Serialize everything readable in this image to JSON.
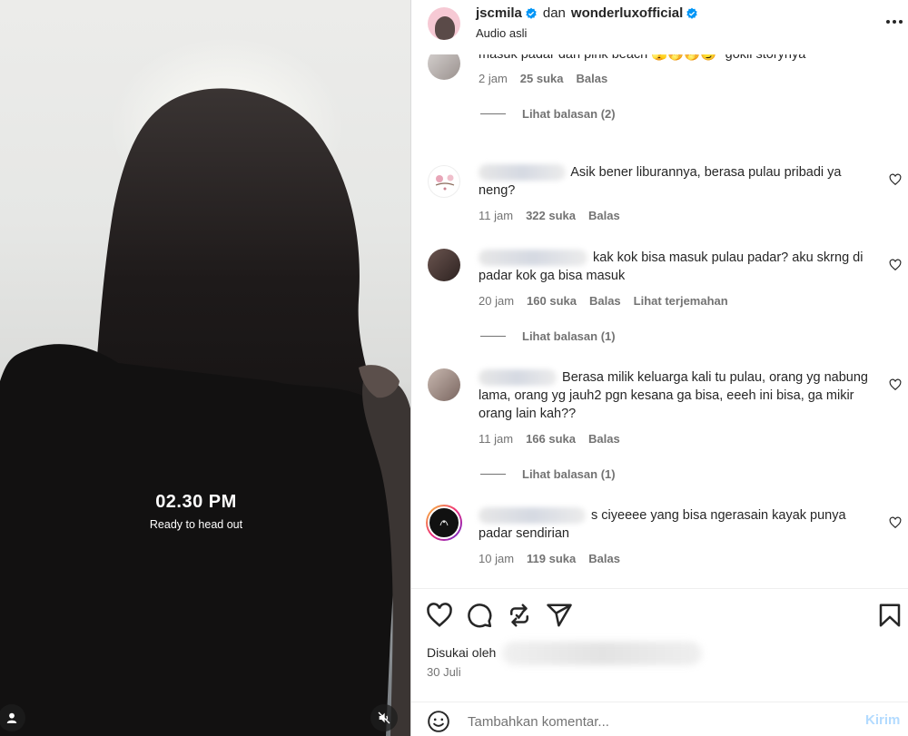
{
  "video": {
    "overlay_time": "02.30 PM",
    "overlay_caption": "Ready to head out",
    "mute_icon": "speaker-muted-icon",
    "user_icon": "user-tag-icon"
  },
  "header": {
    "author": "jscmila",
    "connector": "dan",
    "collaborator": "wonderluxofficial",
    "audio": "Audio asli",
    "more_icon": "more-horizontal-icon"
  },
  "comments": [
    {
      "text_line1": "masuk padar dan pink beach 🫣🤭🤭😏\" gokil storynya",
      "time": "2 jam",
      "likes": "25 suka",
      "reply": "Balas",
      "view_replies": "Lihat balasan (2)"
    },
    {
      "text": "Asik bener liburannya, berasa pulau pribadi ya neng?",
      "time": "11 jam",
      "likes": "322 suka",
      "reply": "Balas"
    },
    {
      "text": "kak kok bisa masuk pulau padar? aku skrng di padar kok ga bisa masuk",
      "time": "20 jam",
      "likes": "160 suka",
      "reply": "Balas",
      "translate": "Lihat terjemahan",
      "view_replies": "Lihat balasan (1)"
    },
    {
      "text": "Berasa milik keluarga kali tu pulau, orang yg nabung lama, orang yg jauh2 pgn kesana ga bisa, eeeh ini bisa, ga mikir orang lain kah??",
      "time": "11 jam",
      "likes": "166 suka",
      "reply": "Balas",
      "view_replies": "Lihat balasan (1)"
    },
    {
      "text": "s ciyeeee yang bisa ngerasain kayak punya padar sendirian",
      "time": "10 jam",
      "likes": "119 suka",
      "reply": "Balas"
    }
  ],
  "actions": {
    "like_icon": "heart-icon",
    "comment_icon": "comment-icon",
    "share_icon": "repost-icon",
    "send_icon": "send-icon",
    "save_icon": "bookmark-icon",
    "liked_by_prefix": "Disukai oleh",
    "date": "30 Juli"
  },
  "add_comment": {
    "emoji_icon": "emoji-icon",
    "placeholder": "Tambahkan komentar...",
    "send_label": "Kirim"
  },
  "colors": {
    "verified": "#0095f6",
    "muted_text": "#737373",
    "text": "#262626",
    "send_disabled": "#b3dbff"
  }
}
